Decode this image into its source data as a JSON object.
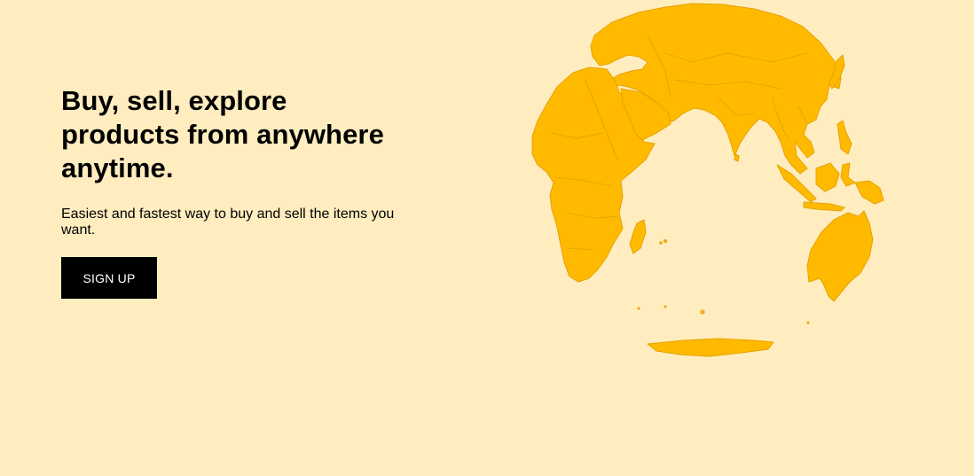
{
  "hero": {
    "headline": "Buy, sell, explore products from anywhere anytime.",
    "subtext": "Easiest and fastest way to buy and sell the items you want.",
    "signup_label": "SIGN UP"
  },
  "colors": {
    "background": "#ffedbf",
    "globe_land": "#ffba00",
    "button_bg": "#000000",
    "button_text": "#ffffff"
  },
  "illustration": {
    "icon": "globe-map-icon"
  }
}
